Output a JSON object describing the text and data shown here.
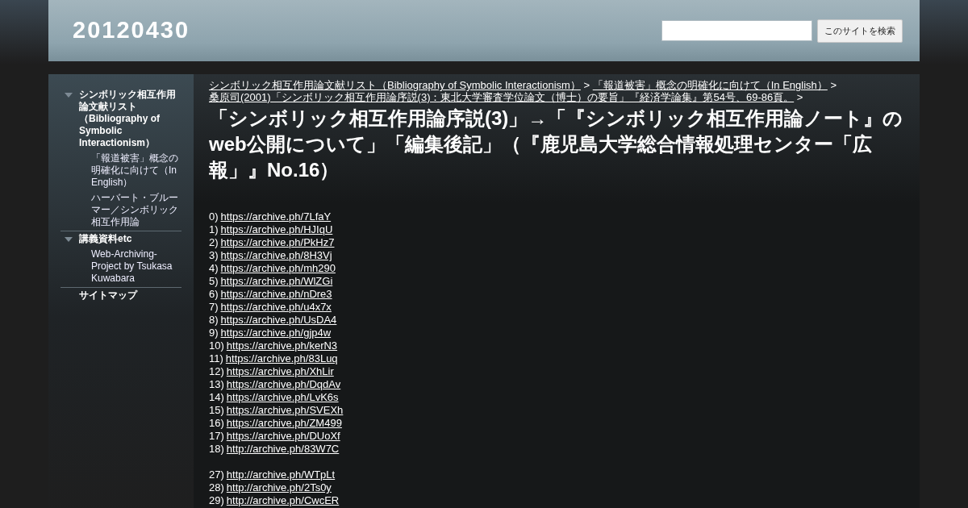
{
  "site_title": "20120430",
  "search": {
    "button": "このサイトを検索"
  },
  "sidebar": {
    "items": [
      {
        "label": "シンボリック相互作用論文献リスト（Bibliography of Symbolic Interactionism）",
        "expanded": true,
        "children": [
          {
            "label": "「報道被害」概念の明確化に向けて（In English）"
          },
          {
            "label": "ハーバート・ブルーマー／シンボリック相互作用論"
          }
        ]
      },
      {
        "label": "講義資料etc",
        "expanded": true,
        "children": [
          {
            "label": "Web-Archiving-Project by Tsukasa Kuwabara"
          }
        ]
      },
      {
        "label": "サイトマップ",
        "expanded": false
      }
    ]
  },
  "breadcrumb": [
    {
      "label": "シンボリック相互作用論文献リスト（Bibliography of Symbolic Interactionism）",
      "separator": ">"
    },
    {
      "label": "「報道被害」概念の明確化に向けて（In English）",
      "separator": ">"
    },
    {
      "label": "桑原司(2001)「シンボリック相互作用論序説(3)：東北大学審査学位論文（博士）の要旨」『経済学論集』第54号、69-86頁。",
      "separator": ">"
    }
  ],
  "page_title": "「シンボリック相互作用論序説(3)」→「『シンボリック相互作用論ノート』のweb公開について」「編集後記」（『鹿児島大学総合情報処理センター「広報」』No.16）",
  "link_groups": [
    [
      {
        "number": "0)",
        "url": "https://archive.ph/7LfaY"
      },
      {
        "number": "1)",
        "url": "https://archive.ph/HJIqU"
      },
      {
        "number": "2)",
        "url": "https://archive.ph/PkHz7"
      },
      {
        "number": "3)",
        "url": "https://archive.ph/8H3Vj"
      },
      {
        "number": "4)",
        "url": "https://archive.ph/mh290"
      },
      {
        "number": "5)",
        "url": "https://archive.ph/WlZGi"
      },
      {
        "number": "6)",
        "url": "https://archive.ph/nDre3"
      },
      {
        "number": "7)",
        "url": "https://archive.ph/u4x7x"
      },
      {
        "number": "8)",
        "url": "https://archive.ph/UsDA4"
      },
      {
        "number": "9)",
        "url": "https://archive.ph/gjp4w"
      },
      {
        "number": "10)",
        "url": "https://archive.ph/kerN3"
      },
      {
        "number": "11)",
        "url": "https://archive.ph/83Luq"
      },
      {
        "number": "12)",
        "url": "https://archive.ph/XhLir"
      },
      {
        "number": "13)",
        "url": "https://archive.ph/DqdAv"
      },
      {
        "number": "14)",
        "url": "https://archive.ph/LvK6s"
      },
      {
        "number": "15)",
        "url": "https://archive.ph/SVEXh"
      },
      {
        "number": "16)",
        "url": "https://archive.ph/ZM499"
      },
      {
        "number": "17)",
        "url": "https://archive.ph/DUoXf"
      },
      {
        "number": "18)",
        "url": "http://archive.ph/83W7C"
      }
    ],
    [
      {
        "number": "27)",
        "url": "http://archive.ph/WTpLt"
      },
      {
        "number": "28)",
        "url": "http://archive.ph/2Ts0y"
      },
      {
        "number": "29)",
        "url": "http://archive.ph/CwcER"
      }
    ]
  ]
}
